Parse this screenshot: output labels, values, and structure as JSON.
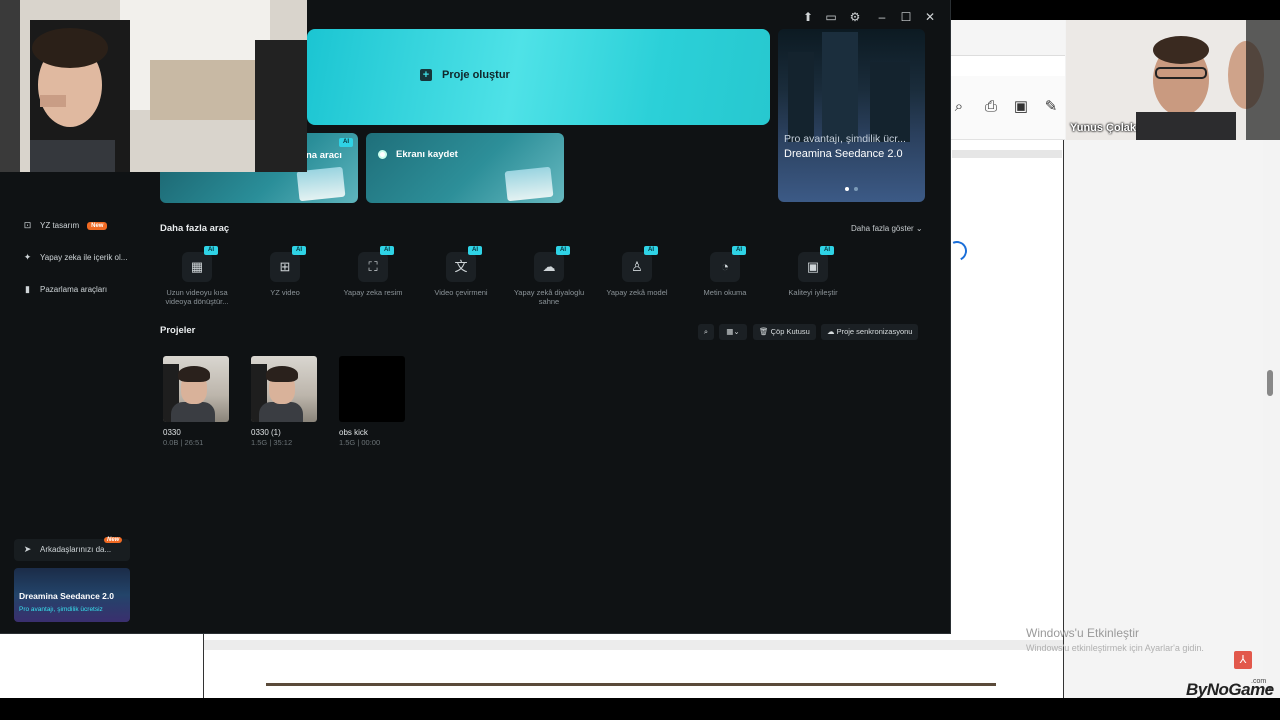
{
  "app": {
    "hero": {
      "create_label": "Proje oluştur"
    },
    "quick_cards": [
      {
        "label": "na aracı",
        "badge": "AI"
      },
      {
        "label": "Ekranı kaydet"
      }
    ],
    "promo": {
      "subtitle": "Pro avantajı, şimdilik ücr...",
      "title": "Dreamina Seedance 2.0"
    },
    "tools_section": {
      "title": "Daha fazla araç",
      "more_label": "Daha fazla göster",
      "items": [
        {
          "label": "Uzun videoyu kısa videoya dönüştür...",
          "icon": "film-icon",
          "badge": "AI"
        },
        {
          "label": "YZ video",
          "icon": "video-plus-icon",
          "badge": "AI"
        },
        {
          "label": "Yapay zeka resim",
          "icon": "image-sparkle-icon",
          "badge": "AI"
        },
        {
          "label": "Video çevirmeni",
          "icon": "translate-icon",
          "badge": "AI"
        },
        {
          "label": "Yapay zekâ diyaloglu sahne",
          "icon": "chat-scene-icon",
          "badge": "AI"
        },
        {
          "label": "Yapay zekâ model",
          "icon": "shirt-icon",
          "badge": "AI"
        },
        {
          "label": "Metin okuma",
          "icon": "voice-icon",
          "badge": "AI"
        },
        {
          "label": "Kaliteyi iyileştir",
          "icon": "hd-icon",
          "badge": "AI"
        }
      ]
    },
    "projects_section": {
      "title": "Projeler",
      "trash_label": "Çöp Kutusu",
      "sync_label": "Proje senkronizasyonu",
      "items": [
        {
          "name": "0330",
          "meta": "0.0B | 26:51"
        },
        {
          "name": "0330 (1)",
          "meta": "1.5G | 35:12"
        },
        {
          "name": "obs kick",
          "meta": "1.5G | 00:00"
        }
      ]
    },
    "sidebar": {
      "items": [
        {
          "label": "YZ tasarım",
          "badge": "New",
          "icon": "ai-design-icon"
        },
        {
          "label": "Yapay zeka ile içerik ol...",
          "icon": "sparkle-icon"
        },
        {
          "label": "Pazarlama araçları",
          "icon": "marketing-icon"
        }
      ],
      "share_label": "Arkadaşlarınızı da...",
      "share_badge": "New",
      "promo_title": "Dreamina Seedance 2.0",
      "promo_sub": "Pro avantajı, şimdilik ücretsiz"
    }
  },
  "webcam": {
    "right_name": "Yunus Çolak"
  },
  "desktop": {
    "activate_title": "Windows'u Etkinleştir",
    "activate_sub": "Windows'u etkinleştirmek için Ayarlar'a gidin.",
    "watermark": "ByNoGame",
    "watermark_suffix": ".com"
  },
  "colors": {
    "accent": "#2fd3e6",
    "new_badge": "#f06a23",
    "background": "#0f1214"
  }
}
